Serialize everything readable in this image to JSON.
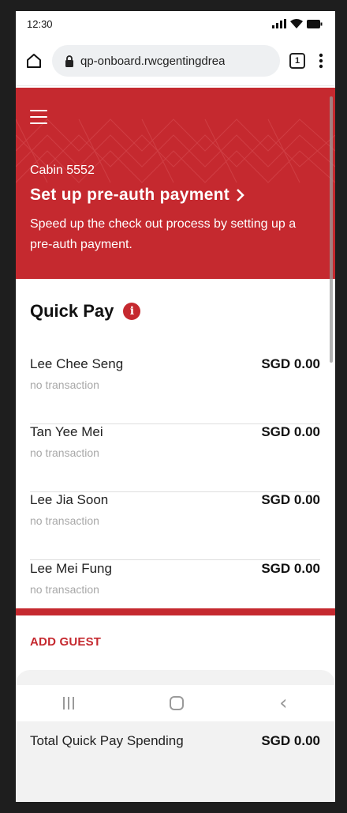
{
  "status": {
    "time": "12:30"
  },
  "browser": {
    "url": "qp-onboard.rwcgentingdrea",
    "tab_count": "1"
  },
  "hero": {
    "cabin": "Cabin 5552",
    "title": "Set up pre-auth payment",
    "description": "Speed up the check out process by setting up a pre-auth payment."
  },
  "quickpay": {
    "title": "Quick Pay",
    "guests": [
      {
        "name": "Lee Chee Seng",
        "status": "no transaction",
        "amount": "SGD 0.00"
      },
      {
        "name": "Tan Yee Mei",
        "status": "no transaction",
        "amount": "SGD 0.00"
      },
      {
        "name": "Lee Jia Soon",
        "status": "no transaction",
        "amount": "SGD 0.00"
      },
      {
        "name": "Lee Mei Fung",
        "status": "no transaction",
        "amount": "SGD 0.00"
      }
    ],
    "add_guest_label": "ADD GUEST",
    "total_label": "Total Quick Pay Spending",
    "total_amount": "SGD 0.00"
  },
  "colors": {
    "accent": "#c5292f"
  },
  "icons": [
    "home-icon",
    "lock-icon",
    "tabs-icon",
    "more-icon",
    "menu-icon",
    "chevron-right-icon",
    "info-icon"
  ]
}
